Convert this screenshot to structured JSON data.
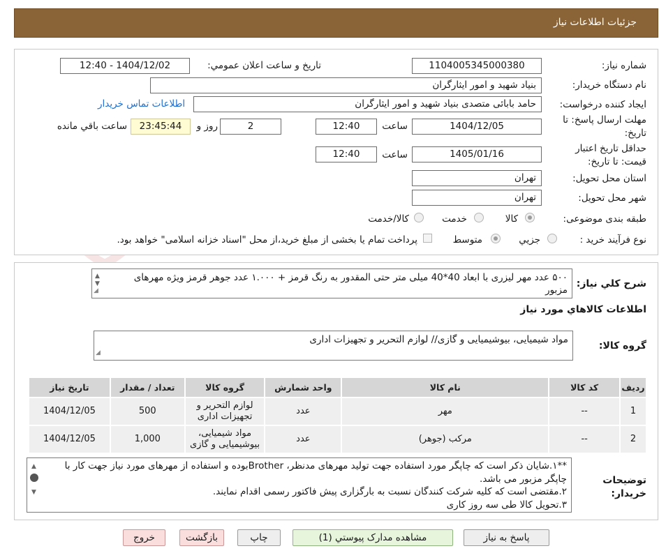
{
  "header": {
    "title": "جزئیات اطلاعات نیاز"
  },
  "watermark": {
    "text": "AriaTender.neT"
  },
  "form": {
    "need_number_label": "شماره نیاز:",
    "need_number": "1104005345000380",
    "announce_label": "تاریخ و ساعت اعلان عمومي:",
    "announce_value": "1404/12/02 - 12:40",
    "buyer_org_label": "نام دستگاه خريدار:",
    "buyer_org": "بنیاد شهید و امور ایثارگران",
    "creator_label": "ایجاد کننده درخواست:",
    "creator": "حامد بابائی متصدی بنیاد شهید و امور ایثارگران",
    "contact_link": "اطلاعات تماس خریدار",
    "deadline_label": "مهلت ارسال پاسخ: تا تاریخ:",
    "deadline_date": "1404/12/05",
    "time_label": "ساعت",
    "deadline_time": "12:40",
    "days_value": "2",
    "days_label": "روز و",
    "remaining_time": "23:45:44",
    "remaining_label": "ساعت باقي مانده",
    "validity_label": "حداقل تاریخ اعتبار قیمت: تا تاریخ:",
    "validity_date": "1405/01/16",
    "validity_time": "12:40",
    "province_label": "استان محل تحویل:",
    "province": "تهران",
    "city_label": "شهر محل تحویل:",
    "city": "تهران",
    "category_label": "طبقه بندی موضوعی:",
    "category_options": [
      "کالا",
      "خدمت",
      "کالا/خدمت"
    ],
    "process_label": "نوع فرآیند خرید :",
    "process_options": [
      "جزیي",
      "متوسط"
    ],
    "payment_note": "پرداخت تمام یا بخشی از مبلغ خرید،از محل \"اسناد خزانه اسلامی\" خواهد بود."
  },
  "summary": {
    "label": "شرح کلي نیاز:",
    "text": "۵۰۰ عدد مهر لیزری با ابعاد 40*40 میلی متر حتی المقدور به رنگ قرمز + ۱.۰۰۰ عدد جوهر قرمز ویژه مهرهای مزبور"
  },
  "goods_section": {
    "title": "اطلاعات کالاهاي مورد نیاز",
    "group_label": "گروه کالا:",
    "group_value": "مواد شیمیایی، بیوشیمیایی و  گازی// لوازم التحریر و تجهیزات اداری"
  },
  "table": {
    "headers": [
      "ردیف",
      "کد کالا",
      "نام کالا",
      "واحد شمارش",
      "گروه کالا",
      "تعداد / مقدار",
      "تاریخ نیاز"
    ],
    "rows": [
      [
        "1",
        "--",
        "مهر",
        "عدد",
        "لوازم التحریر و تجهیزات اداری",
        "500",
        "1404/12/05"
      ],
      [
        "2",
        "--",
        "مرکب (جوهر)",
        "عدد",
        "مواد شیمیایی، بیوشیمیایی و گازی",
        "1,000",
        "1404/12/05"
      ]
    ]
  },
  "notes": {
    "label": "توضیحات خریدار:",
    "lines": [
      "**۱.شایان ذکر است که چاپگر مورد استفاده جهت تولید مهرهای مدنظر، Brotherبوده و استفاده از مهرهای مورد نیاز جهت کار با چاپگر مزبور می باشد.",
      "۲.مقتضی است که کلیه شرکت کنندگان نسبت به بارگزاری پیش فاکتور رسمی اقدام نمایند.",
      "۳.تحویل کالا طی سه روز کاری"
    ]
  },
  "buttons": {
    "reply": "پاسخ به نیاز",
    "attachments": "مشاهده مدارک پیوستي (1)",
    "print": "چاپ",
    "back": "بازگشت",
    "exit": "خروج"
  }
}
